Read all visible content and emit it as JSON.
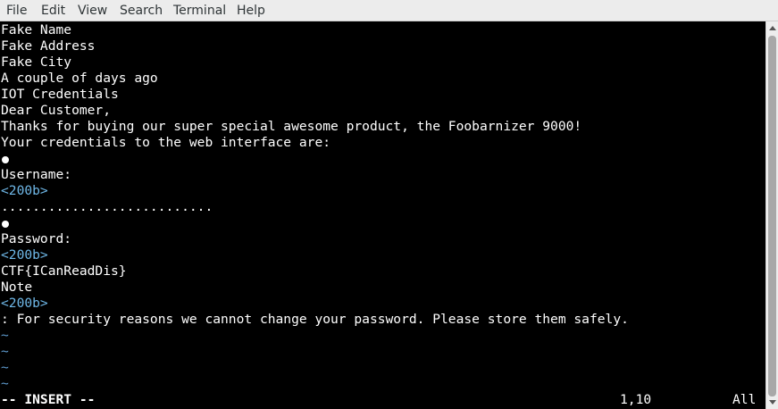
{
  "menubar": {
    "file": "File",
    "edit": "Edit",
    "view": "View",
    "search": "Search",
    "terminal": "Terminal",
    "help": "Help"
  },
  "buffer": {
    "line1": "Fake Name",
    "line2": "Fake Address",
    "line3": "Fake City",
    "line4": "A couple of days ago",
    "line5": "IOT Credentials",
    "line6": "Dear Customer,",
    "line7": "Thanks for buying our super special awesome product, the Foobarnizer 9000!",
    "line8": "Your credentials to the web interface are:",
    "line10": "Username:",
    "line11": "<200b>",
    "line12": "...........................",
    "line14": "Password:",
    "line15": "<200b>",
    "line16": "CTF{ICanReadDis}",
    "line17": "Note",
    "line18": "<200b>",
    "line19": ": For security reasons we cannot change your password. Please store them safely.",
    "empty_marker": "~"
  },
  "statusline": {
    "mode": "-- INSERT --",
    "position": "1,10",
    "scroll": "All"
  },
  "colors": {
    "background": "#000000",
    "text": "#ffffff",
    "special_key": "#6fb8e8",
    "nontext_tilde": "#5c97c9",
    "menubar_bg": "#ececec"
  }
}
